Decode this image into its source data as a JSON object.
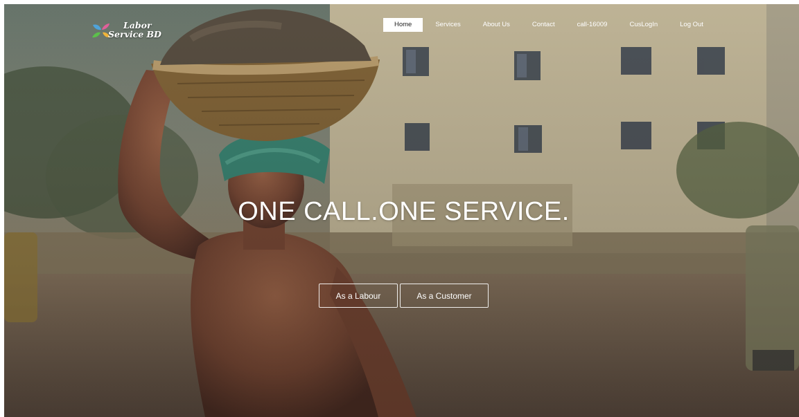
{
  "brand": {
    "line1": "Labor",
    "line2": "Service BD",
    "logo_icon": "leaf-butterfly-logo"
  },
  "nav": {
    "items": [
      {
        "label": "Home",
        "active": true
      },
      {
        "label": "Services",
        "active": false
      },
      {
        "label": "About Us",
        "active": false
      },
      {
        "label": "Contact",
        "active": false
      },
      {
        "label": "call-16009",
        "active": false
      },
      {
        "label": "CusLogIn",
        "active": false
      },
      {
        "label": "Log Out",
        "active": false
      }
    ]
  },
  "hero": {
    "headline": "ONE CALL.ONE SERVICE.",
    "buttons": {
      "labour": "As a Labour",
      "customer": "As a Customer"
    },
    "background": "photo-labourer-carrying-basket"
  },
  "colors": {
    "nav_text": "#ffffff",
    "active_tab_bg": "#ffffff",
    "active_tab_text": "#222222",
    "logo_blue": "#4fa3d9",
    "logo_pink": "#e0609a",
    "logo_green": "#5cc04b",
    "logo_orange": "#f0b43a"
  }
}
